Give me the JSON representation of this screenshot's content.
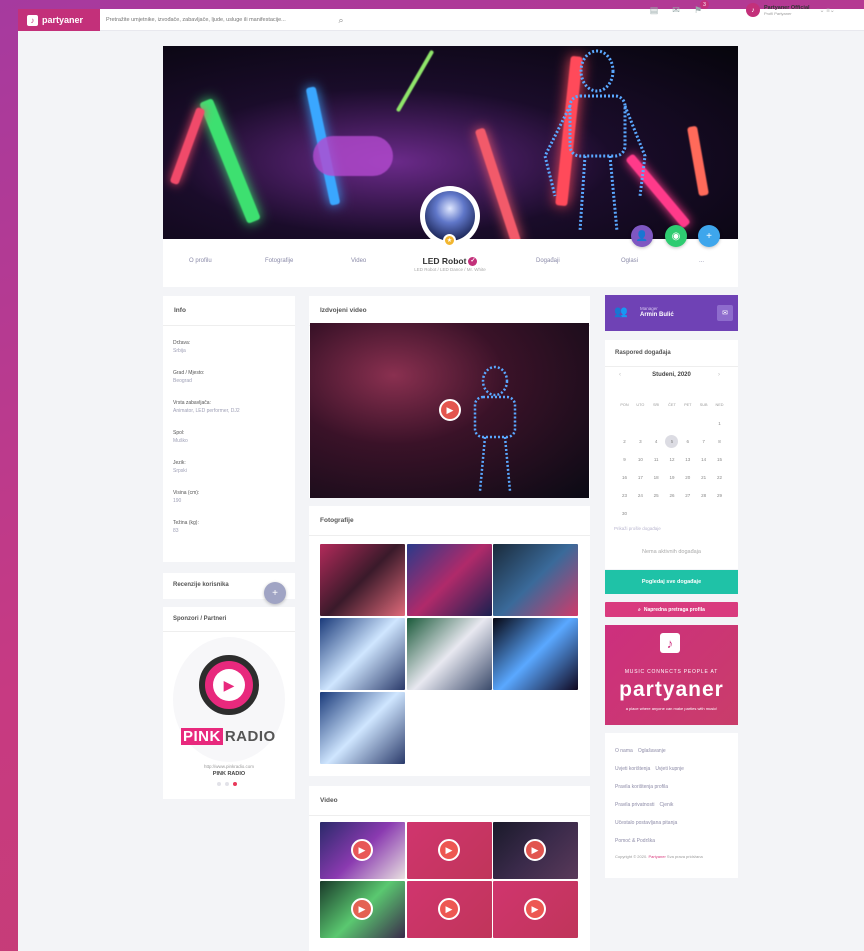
{
  "topbar": {
    "logo_text": "partyaner",
    "search_placeholder": "Pretražite umjetnike, izvođače, zabavljače, ljude, usluge ili manifestacije...",
    "notif_count": "3",
    "user_name": "Partyaner Official",
    "user_sub": "Profil Partyaner"
  },
  "profile": {
    "name": "LED Robot",
    "subtitle": "LED Robot / LED Dance / Mr. White",
    "tabs": [
      "O profilu",
      "Fotografije",
      "Video",
      "Događaji",
      "Oglasi",
      "..."
    ]
  },
  "info": {
    "title": "Info",
    "fields": [
      {
        "label": "Država:",
        "value": "Srbija"
      },
      {
        "label": "Grad / Mjesto:",
        "value": "Beograd"
      },
      {
        "label": "Vrsta zabavljača:",
        "value": "Animator, LED performer, DJ2"
      },
      {
        "label": "Spol:",
        "value": "Muško"
      },
      {
        "label": "Jezik:",
        "value": "Srpski"
      },
      {
        "label": "Visina (cm):",
        "value": "190"
      },
      {
        "label": "Težina (kg):",
        "value": "83"
      }
    ]
  },
  "reviews": {
    "title": "Recenzije korisnika"
  },
  "sponsors": {
    "title": "Sponzori / Partneri",
    "brand_main": "PINK",
    "brand_rest": "RADIO",
    "url": "http://www.pinkradio.com",
    "name": "PINK RADIO"
  },
  "featured": {
    "title": "Izdvojeni video"
  },
  "photos": {
    "title": "Fotografije"
  },
  "videos": {
    "title": "Video"
  },
  "manager": {
    "label": "Manager",
    "name": "Armin Bulić"
  },
  "schedule": {
    "title": "Raspored događaja",
    "month": "Studeni, 2020",
    "days": [
      "PON",
      "UTO",
      "SRI",
      "ČET",
      "PET",
      "SUB",
      "NED"
    ],
    "weeks": [
      [
        "",
        "",
        "",
        "",
        "",
        "",
        "1"
      ],
      [
        "2",
        "3",
        "4",
        "5",
        "6",
        "7",
        "8"
      ],
      [
        "9",
        "10",
        "11",
        "12",
        "13",
        "14",
        "15"
      ],
      [
        "16",
        "17",
        "18",
        "19",
        "20",
        "21",
        "22"
      ],
      [
        "23",
        "24",
        "25",
        "26",
        "27",
        "28",
        "29"
      ],
      [
        "30",
        "",
        "",
        "",
        "",
        "",
        ""
      ]
    ],
    "past_events": "Prikaži prošle događaje",
    "empty": "Nema aktivnih događaja",
    "all_button": "Pogledaj sve događaje",
    "advanced_search": "Napredna pretraga profila"
  },
  "ad": {
    "tagline": "MUSIC CONNECTS PEOPLE AT",
    "brand": "partyaner",
    "bottom": "a place where anyone can make parties with music!"
  },
  "footer": {
    "links": [
      "O nama",
      "Oglašavanje",
      "Uvjeti korištenja",
      "Uvjeti kupnje",
      "Pravila korištenja profila",
      "Pravila privatnosti",
      "Cjenik",
      "Učestalo postavljana pitanja",
      "Pomoć & Podrška"
    ],
    "copyright_pre": "Copyright © 2020.",
    "copyright_brand": "Partyaner",
    "copyright_post": "Sva prava pridržana"
  }
}
